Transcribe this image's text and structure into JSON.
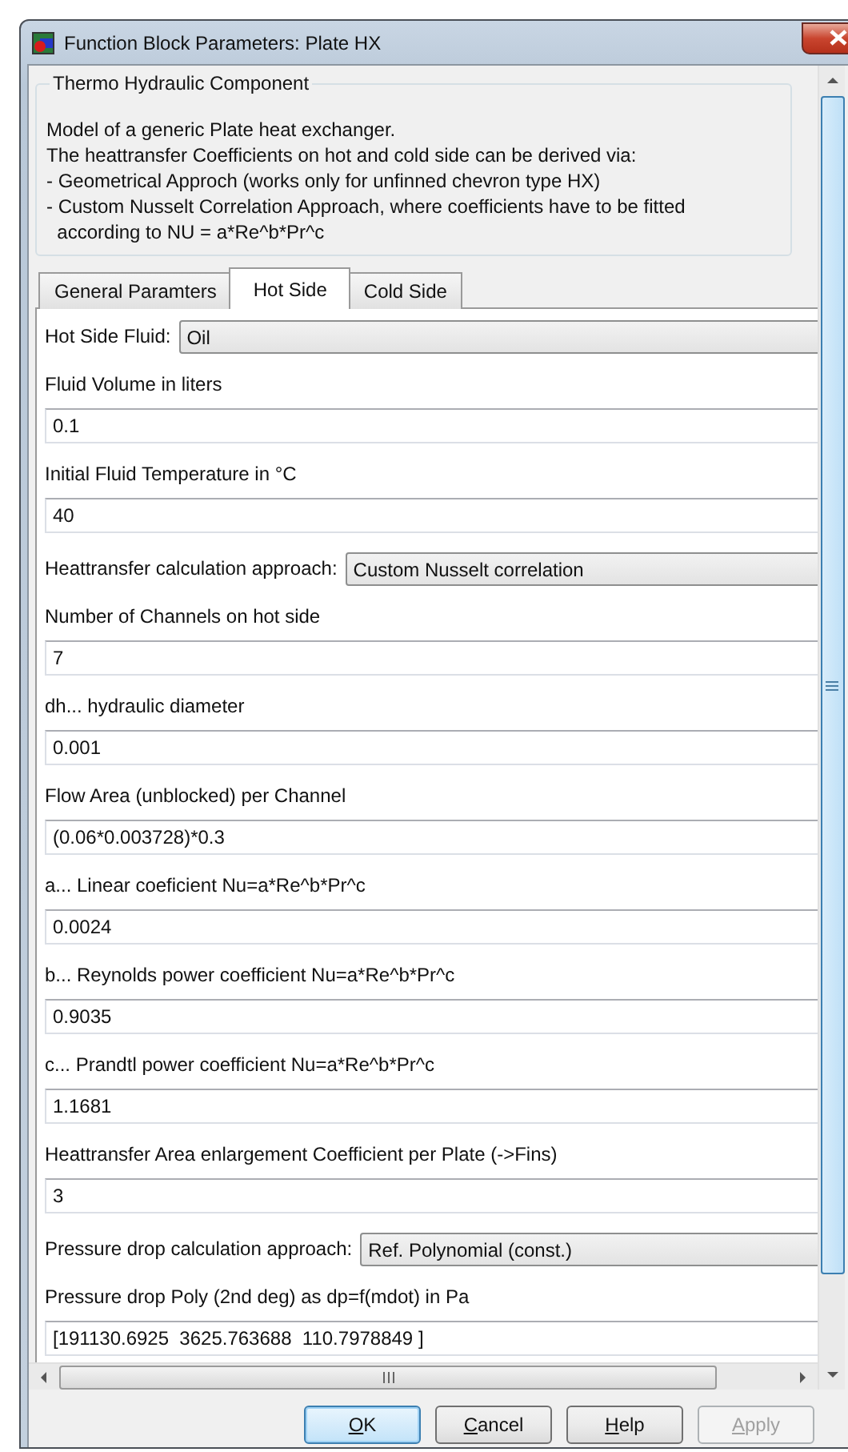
{
  "window": {
    "title": "Function Block Parameters: Plate HX"
  },
  "group": {
    "title": "Thermo Hydraulic Component",
    "description": "Model of a generic Plate heat exchanger.\nThe heattransfer Coefficients on hot and cold side can be derived via:\n- Geometrical Approch (works only for unfinned chevron type HX)\n- Custom Nusselt Correlation Approach, where coefficients have to be fitted\n  according to NU = a*Re^b*Pr^c"
  },
  "tabs": [
    {
      "label": "General Paramters",
      "selected": false
    },
    {
      "label": "Hot Side",
      "selected": true
    },
    {
      "label": "Cold Side",
      "selected": false
    }
  ],
  "params": [
    {
      "kind": "select",
      "label": "Hot Side Fluid:",
      "value": "Oil"
    },
    {
      "kind": "text",
      "label": "Fluid Volume in liters",
      "value": "0.1"
    },
    {
      "kind": "text",
      "label": "Initial Fluid Temperature in °C",
      "value": "40"
    },
    {
      "kind": "select",
      "label": "Heattransfer calculation approach:",
      "value": "Custom Nusselt correlation"
    },
    {
      "kind": "text",
      "label": "Number of Channels on hot side",
      "value": "7"
    },
    {
      "kind": "text",
      "label": "dh... hydraulic diameter",
      "value": "0.001"
    },
    {
      "kind": "text",
      "label": "Flow Area (unblocked) per Channel",
      "value": "(0.06*0.003728)*0.3"
    },
    {
      "kind": "text",
      "label": "a... Linear coeficient Nu=a*Re^b*Pr^c",
      "value": "0.0024"
    },
    {
      "kind": "text",
      "label": "b... Reynolds power coefficient Nu=a*Re^b*Pr^c",
      "value": "0.9035"
    },
    {
      "kind": "text",
      "label": "c... Prandtl power coefficient Nu=a*Re^b*Pr^c",
      "value": "1.1681"
    },
    {
      "kind": "text",
      "label": "Heattransfer Area enlargement Coefficient per Plate (->Fins)",
      "value": "3"
    },
    {
      "kind": "select",
      "label": "Pressure drop calculation approach:",
      "value": "Ref. Polynomial (const.)"
    },
    {
      "kind": "text",
      "label": "Pressure drop Poly (2nd deg) as dp=f(mdot) in Pa",
      "value": "[191130.6925  3625.763688  110.7978849 ]"
    }
  ],
  "buttons": [
    {
      "label": "OK",
      "mnemonic": true,
      "default": true,
      "disabled": false
    },
    {
      "label": "Cancel",
      "mnemonic": true,
      "default": false,
      "disabled": false
    },
    {
      "label": "Help",
      "mnemonic": true,
      "default": false,
      "disabled": false
    },
    {
      "label": "Apply",
      "mnemonic": true,
      "default": false,
      "disabled": true
    }
  ]
}
